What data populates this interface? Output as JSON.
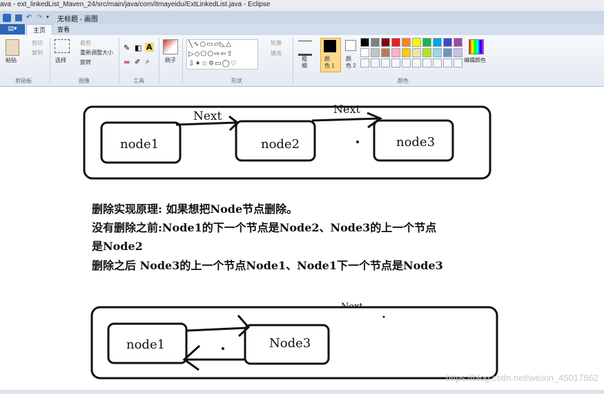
{
  "window": {
    "title": "ava - ext_linkedList_Maven_24/src/main/java/com/itmayeidu/ExtLinkedList.java - Eclipse",
    "paint_title": "无标题 - 画图"
  },
  "ribbon": {
    "file_label": "▤▾",
    "tabs": [
      "主页",
      "查看"
    ],
    "clipboard": {
      "paste": "粘贴",
      "cut": "剪切",
      "copy": "复制",
      "group": "剪贴板"
    },
    "image": {
      "select": "选择",
      "crop": "裁剪",
      "resize": "重新调整大小",
      "rotate": "旋转",
      "group": "图像"
    },
    "tools": {
      "group": "工具"
    },
    "brushes": {
      "label": "刷子"
    },
    "shapes": {
      "outline": "轮廓",
      "fill": "填充",
      "group": "形状"
    },
    "size": {
      "label": "粗\n细"
    },
    "colors": {
      "color1": "颜\n色 1",
      "color2": "颜\n色 2",
      "edit": "编辑颜色",
      "group": "颜色",
      "palette_row1": [
        "#000000",
        "#7f7f7f",
        "#880015",
        "#ed1c24",
        "#ff7f27",
        "#fff200",
        "#22b14c",
        "#00a2e8",
        "#3f48cc",
        "#a349a4"
      ],
      "palette_row2": [
        "#ffffff",
        "#c3c3c3",
        "#b97a57",
        "#ffaec9",
        "#ffc90e",
        "#efe4b0",
        "#b5e61d",
        "#99d9ea",
        "#7092be",
        "#c8bfe7"
      ]
    }
  },
  "drawing": {
    "top_diagram": {
      "nodes": [
        "node1",
        "node2",
        "node3"
      ],
      "arrow_labels": [
        "Next",
        "Next"
      ]
    },
    "text_lines": [
      "删除实现原理: 如果想把Node节点删除。",
      "没有删除之前:Node1的下一个节点是Node2、Node3的上一个节点",
      "是Node2",
      "删除之后 Node3的上一个节点Node1、Node1下一个节点是Node3"
    ],
    "bottom_diagram": {
      "nodes": [
        "node1",
        "Node3"
      ],
      "partial_label": "Next"
    }
  },
  "watermark": "https://blog.csdn.net/weixin_45017862"
}
